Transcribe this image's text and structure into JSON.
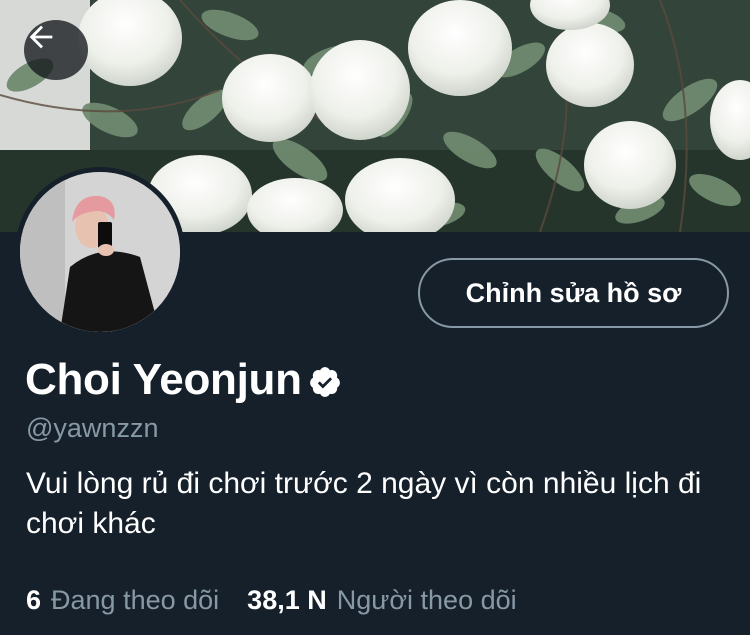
{
  "header": {
    "back_icon": "arrow-left-icon"
  },
  "profile": {
    "display_name": "Choi Yeonjun",
    "verified_icon": "verified-badge-icon",
    "handle": "@yawnzzn",
    "bio": "Vui lòng rủ đi chơi trước 2 ngày vì còn nhiều lịch đi chơi khác",
    "edit_button_label": "Chỉnh sửa hồ sơ"
  },
  "stats": {
    "following_count": "6",
    "following_label": "Đang theo dõi",
    "followers_count": "38,1 N",
    "followers_label": "Người theo dõi"
  },
  "colors": {
    "background": "#15202b",
    "primary_text": "#ffffff",
    "secondary_text": "#8899a6",
    "border": "#8899a6"
  }
}
